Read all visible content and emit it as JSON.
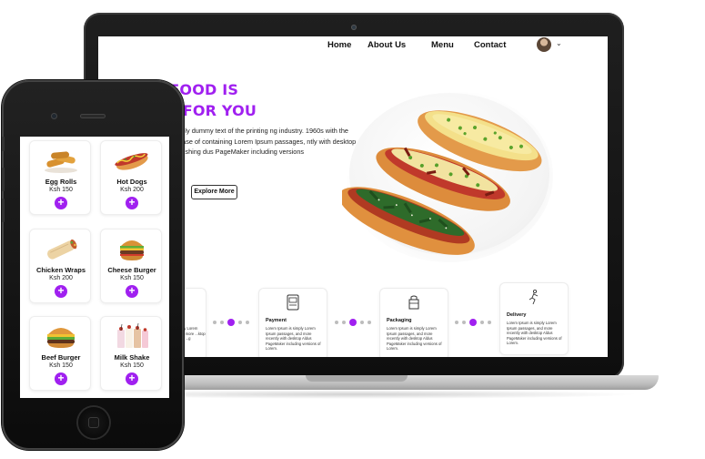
{
  "brand_color": "#a020f0",
  "website": {
    "nav": {
      "items": [
        "Home",
        "About Us",
        "Menu",
        "Contact"
      ],
      "avatar_icon": "user-avatar",
      "dropdown_icon": "chevron-down-icon"
    },
    "hero": {
      "title_line1": "R FOOD IS",
      "title_line2": "NG FOR YOU",
      "text": "simply dummy text of the printing ng industry. 1960s with the release of containing Lorem Ipsum passages, ntly with desktop publishing dus PageMaker including versions",
      "explore_button": "Explore More"
    },
    "features": [
      {
        "title": "",
        "text": "...mply Lorem ...and more ...ktop Aldus ...g",
        "icon": "cook-icon"
      },
      {
        "title": "Payment",
        "text": "Lorem Ipsum is simply Lorem Ipsum passages, and more recently with desktop Aldus PageMaker including versions of Lorem.",
        "icon": "payment-icon"
      },
      {
        "title": "Packaging",
        "text": "Lorem Ipsum is simply Lorem Ipsum passages, and more recently with desktop Aldus PageMaker including versions of Lorem.",
        "icon": "package-icon"
      },
      {
        "title": "Delivery",
        "text": "Lorem Ipsum is simply Lorem Ipsum passages, and more recently with desktop Aldus PageMaker including versions of Lorem.",
        "icon": "delivery-icon"
      }
    ]
  },
  "mobile": {
    "menu": [
      {
        "name": "Egg Rolls",
        "price": "Ksh 150",
        "icon": "egg-rolls-image"
      },
      {
        "name": "Hot Dogs",
        "price": "Ksh 200",
        "icon": "hot-dog-image"
      },
      {
        "name": "Chicken Wraps",
        "price": "Ksh 200",
        "icon": "chicken-wrap-image"
      },
      {
        "name": "Cheese Burger",
        "price": "Ksh 150",
        "icon": "cheese-burger-image"
      },
      {
        "name": "Beef Burger",
        "price": "Ksh 150",
        "icon": "beef-burger-image"
      },
      {
        "name": "Milk Shake",
        "price": "Ksh 150",
        "icon": "milk-shake-image"
      }
    ],
    "add_symbol": "+"
  }
}
